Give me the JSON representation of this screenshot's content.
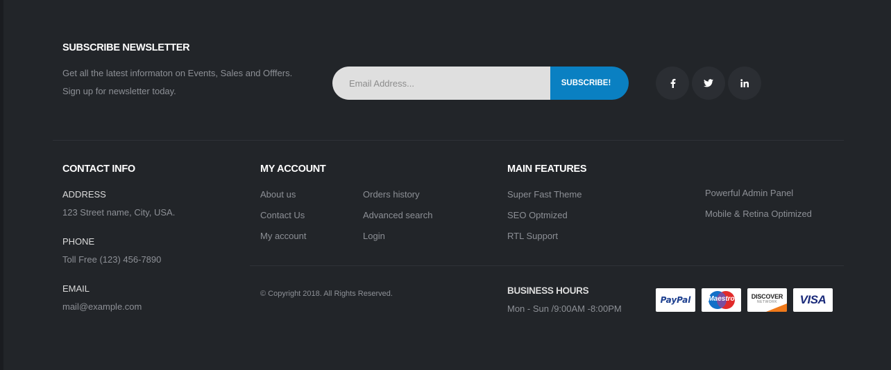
{
  "newsletter": {
    "title": "SUBSCRIBE NEWSLETTER",
    "line1": "Get all the latest informaton on Events, Sales and Offfers.",
    "line2": "Sign up for newsletter today.",
    "email_placeholder": "Email Address...",
    "button_label": "SUBSCRIBE!"
  },
  "social": [
    "facebook-icon",
    "twitter-icon",
    "linkedin-icon"
  ],
  "contact": {
    "title": "CONTACT INFO",
    "address_label": "ADDRESS",
    "address": "123 Street name, City, USA.",
    "phone_label": "PHONE",
    "phone": "Toll Free (123) 456-7890",
    "email_label": "EMAIL",
    "email": "mail@example.com"
  },
  "account": {
    "title": "MY ACCOUNT",
    "col1": [
      "About us",
      "Contact Us",
      "My account"
    ],
    "col2": [
      "Orders history",
      "Advanced search",
      "Login"
    ]
  },
  "features": {
    "title": "MAIN FEATURES",
    "col1": [
      "Super Fast Theme",
      "SEO Optmized",
      "RTL Support"
    ],
    "col2": [
      "Powerful Admin Panel",
      "Mobile & Retina Optimized"
    ]
  },
  "copyright": "© Copyright 2018. All Rights Reserved.",
  "hours": {
    "title": "BUSINESS HOURS",
    "text": "Mon - Sun /9:00AM -8:00PM"
  },
  "payments": {
    "paypal": "PayPal",
    "maestro": "Maestro",
    "discover": "DISCOVER",
    "discover_sub": "NETWORK",
    "visa": "VISA"
  },
  "colors": {
    "background": "#222529",
    "accent": "#0a80c2",
    "heading": "#ffffff",
    "muted_text": "#8d9096"
  }
}
